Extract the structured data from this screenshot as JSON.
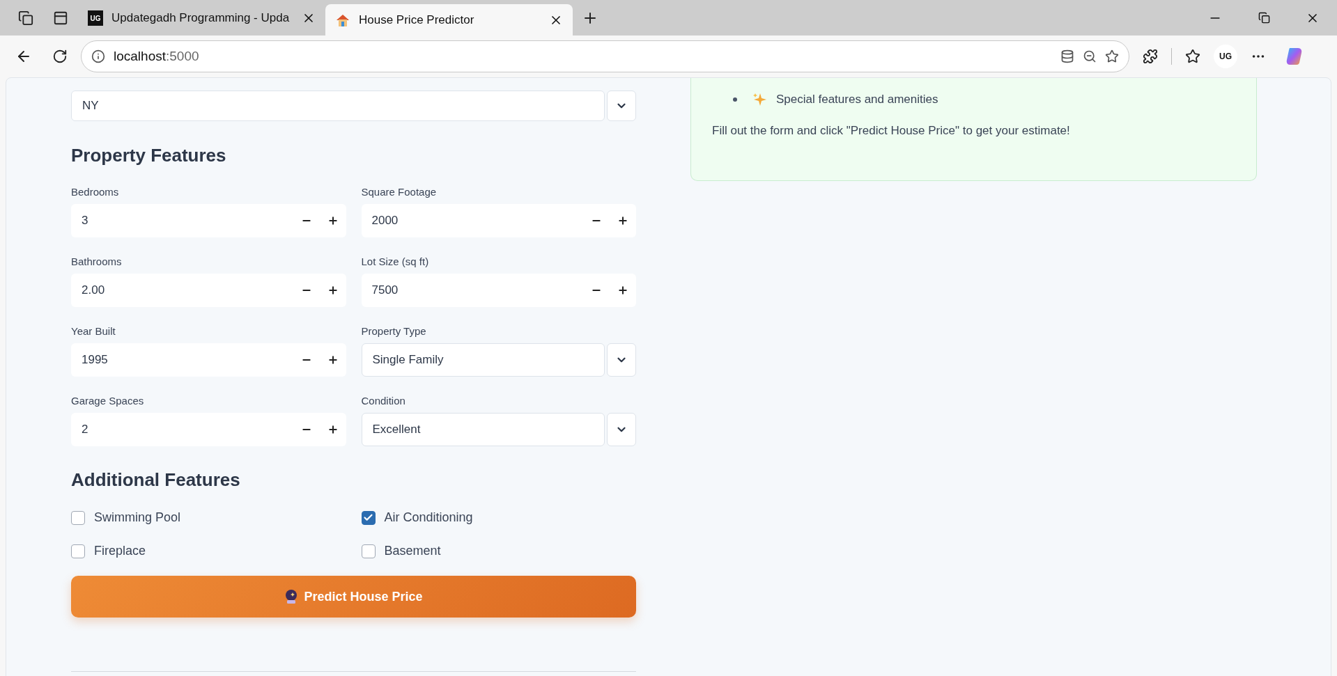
{
  "browser": {
    "tabs": [
      {
        "title": "Updategadh Programming - Upda",
        "selected": false,
        "kind": "logo",
        "logo_text": "UG"
      },
      {
        "title": "House Price Predictor",
        "selected": true,
        "kind": "house"
      }
    ],
    "address": {
      "host": "localhost",
      "port": ":5000"
    },
    "profile": {
      "initials": "UG"
    }
  },
  "form": {
    "state_select": {
      "value": "NY"
    },
    "property_heading": "Property Features",
    "fields": [
      {
        "label": "Bedrooms",
        "kind": "number",
        "value": "3"
      },
      {
        "label": "Square Footage",
        "kind": "number",
        "value": "2000"
      },
      {
        "label": "Bathrooms",
        "kind": "number",
        "value": "2.00"
      },
      {
        "label": "Lot Size (sq ft)",
        "kind": "number",
        "value": "7500"
      },
      {
        "label": "Year Built",
        "kind": "number",
        "value": "1995"
      },
      {
        "label": "Property Type",
        "kind": "select",
        "value": "Single Family"
      },
      {
        "label": "Garage Spaces",
        "kind": "number",
        "value": "2"
      },
      {
        "label": "Condition",
        "kind": "select",
        "value": "Excellent"
      }
    ],
    "additional_heading": "Additional Features",
    "checkboxes": [
      {
        "label": "Swimming Pool",
        "checked": false
      },
      {
        "label": "Air Conditioning",
        "checked": true
      },
      {
        "label": "Fireplace",
        "checked": false
      },
      {
        "label": "Basement",
        "checked": false
      }
    ],
    "submit": {
      "label": "Predict House Price"
    }
  },
  "info_panel": {
    "items": [
      {
        "text": "Special features and amenities"
      }
    ],
    "note": "Fill out the form and click \"Predict House Price\" to get your estimate!"
  }
}
